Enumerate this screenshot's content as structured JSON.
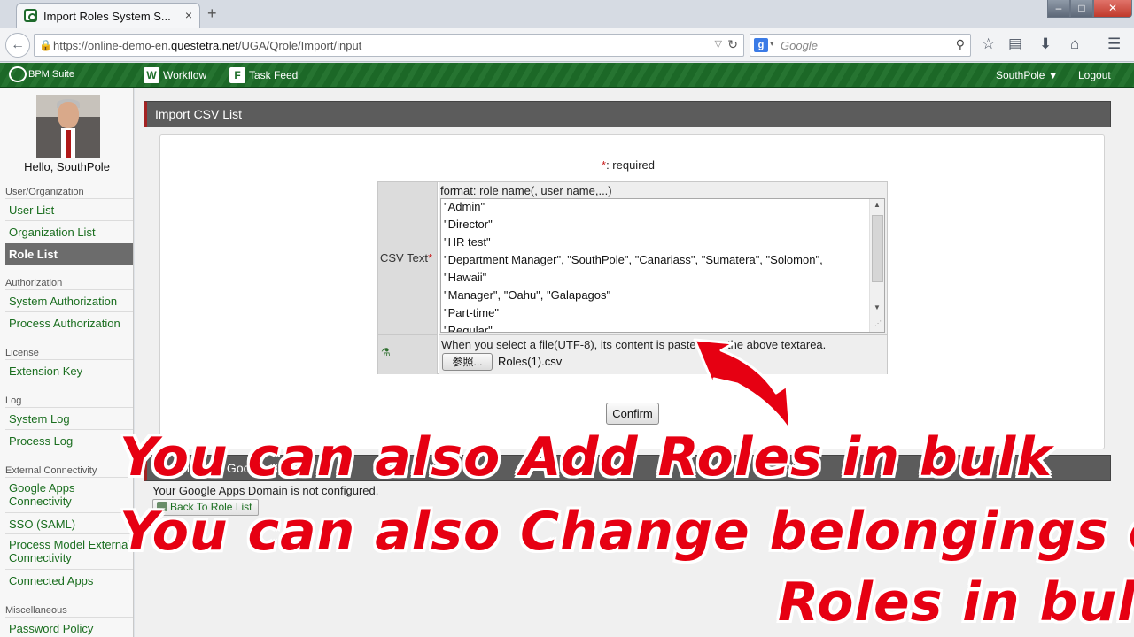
{
  "browser": {
    "tab_title": "Import Roles System S...",
    "tab_close": "×",
    "new_tab": "+",
    "url_prefix": "https://online-demo-en.",
    "url_host": "questetra.net",
    "url_path": "/UGA/Qrole/Import/input",
    "search_placeholder": "Google",
    "search_engine_icon": "g-icon"
  },
  "appbar": {
    "brand": "BPM Suite",
    "nav": [
      {
        "icon": "W",
        "label": "Workflow"
      },
      {
        "icon": "F",
        "label": "Task Feed"
      }
    ],
    "user_menu": "SouthPole ▼",
    "logout": "Logout"
  },
  "sidebar": {
    "hello": "Hello, SouthPole",
    "sections": {
      "user_org": "User/Organization",
      "authorization": "Authorization",
      "license": "License",
      "log": "Log",
      "external": "External Connectivity",
      "misc": "Miscellaneous"
    },
    "items": {
      "user_list": "User List",
      "organization_list": "Organization List",
      "role_list": "Role List",
      "system_authorization": "System Authorization",
      "process_authorization": "Process Authorization",
      "extension_key": "Extension Key",
      "system_log": "System Log",
      "process_log": "Process Log",
      "google_apps_1": "Google Apps",
      "google_apps_2": "Connectivity",
      "sso": "SSO (SAML)",
      "pm_external_1": "Process Model External",
      "pm_external_2": "Connectivity",
      "connected_apps": "Connected Apps",
      "password_policy": "Password Policy"
    }
  },
  "main": {
    "title": "Import CSV List",
    "required_note": ": required",
    "required_star": "*",
    "csv_label": "CSV Text",
    "format_hint": "format: role name(, user name,...)",
    "csv_lines": [
      "\"Admin\"",
      "\"Director\"",
      "\"HR test\"",
      "\"Department Manager\", \"SouthPole\", \"Canariass\", \"Sumatera\", \"Solomon\",",
      "\"Hawaii\"",
      "\"Manager\", \"Oahu\", \"Galapagos\"",
      "\"Part-time\"",
      "\"Regular\""
    ],
    "file_note": "When you select a file(UTF-8), its content is pasted into the above textarea.",
    "browse_button": "参照...",
    "file_name": "Roles(1).csv",
    "confirm_button": "Confirm",
    "section2_title": "Synchronize Google Apps",
    "gapps_status": "Your Google Apps Domain is not configured.",
    "back_button": "Back To Role List"
  },
  "overlay": {
    "caption1": "You can also Add Roles in bulk",
    "caption2": "You can also Change belongings of",
    "caption3": "Roles in bulk",
    "color": "#e60012"
  }
}
